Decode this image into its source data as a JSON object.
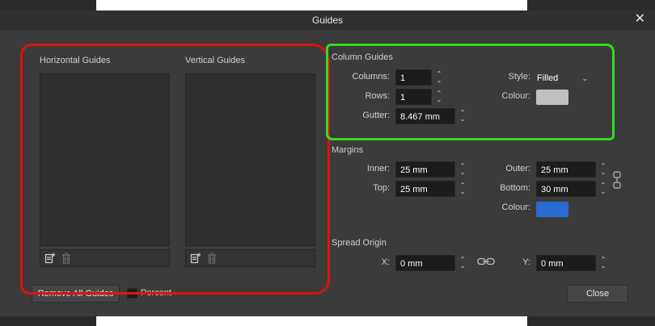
{
  "dialog": {
    "title": "Guides"
  },
  "horizontal": {
    "label": "Horizontal Guides"
  },
  "vertical": {
    "label": "Vertical Guides"
  },
  "column_guides": {
    "label": "Column Guides",
    "columns_label": "Columns:",
    "columns_value": "1",
    "rows_label": "Rows:",
    "rows_value": "1",
    "gutter_label": "Gutter:",
    "gutter_value": "8.467 mm",
    "style_label": "Style:",
    "style_value": "Filled",
    "colour_label": "Colour:",
    "colour": "#c0c0c0"
  },
  "margins": {
    "label": "Margins",
    "inner_label": "Inner:",
    "inner_value": "25 mm",
    "top_label": "Top:",
    "top_value": "25 mm",
    "outer_label": "Outer:",
    "outer_value": "25 mm",
    "bottom_label": "Bottom:",
    "bottom_value": "30 mm",
    "colour_label": "Colour:",
    "colour": "#2a6bd0"
  },
  "spread_origin": {
    "label": "Spread Origin",
    "x_label": "X:",
    "x_value": "0 mm",
    "y_label": "Y:",
    "y_value": "0 mm"
  },
  "footer": {
    "remove_all_label": "Remove All Guides",
    "percent_label": "Percent",
    "close_label": "Close"
  },
  "icons": [
    "close-icon",
    "add-guide-icon",
    "delete-guide-icon",
    "spinner-icon",
    "chevron-down-icon",
    "link-icon"
  ],
  "annotation_colors": {
    "red": "#e01010",
    "green": "#33dd22"
  }
}
